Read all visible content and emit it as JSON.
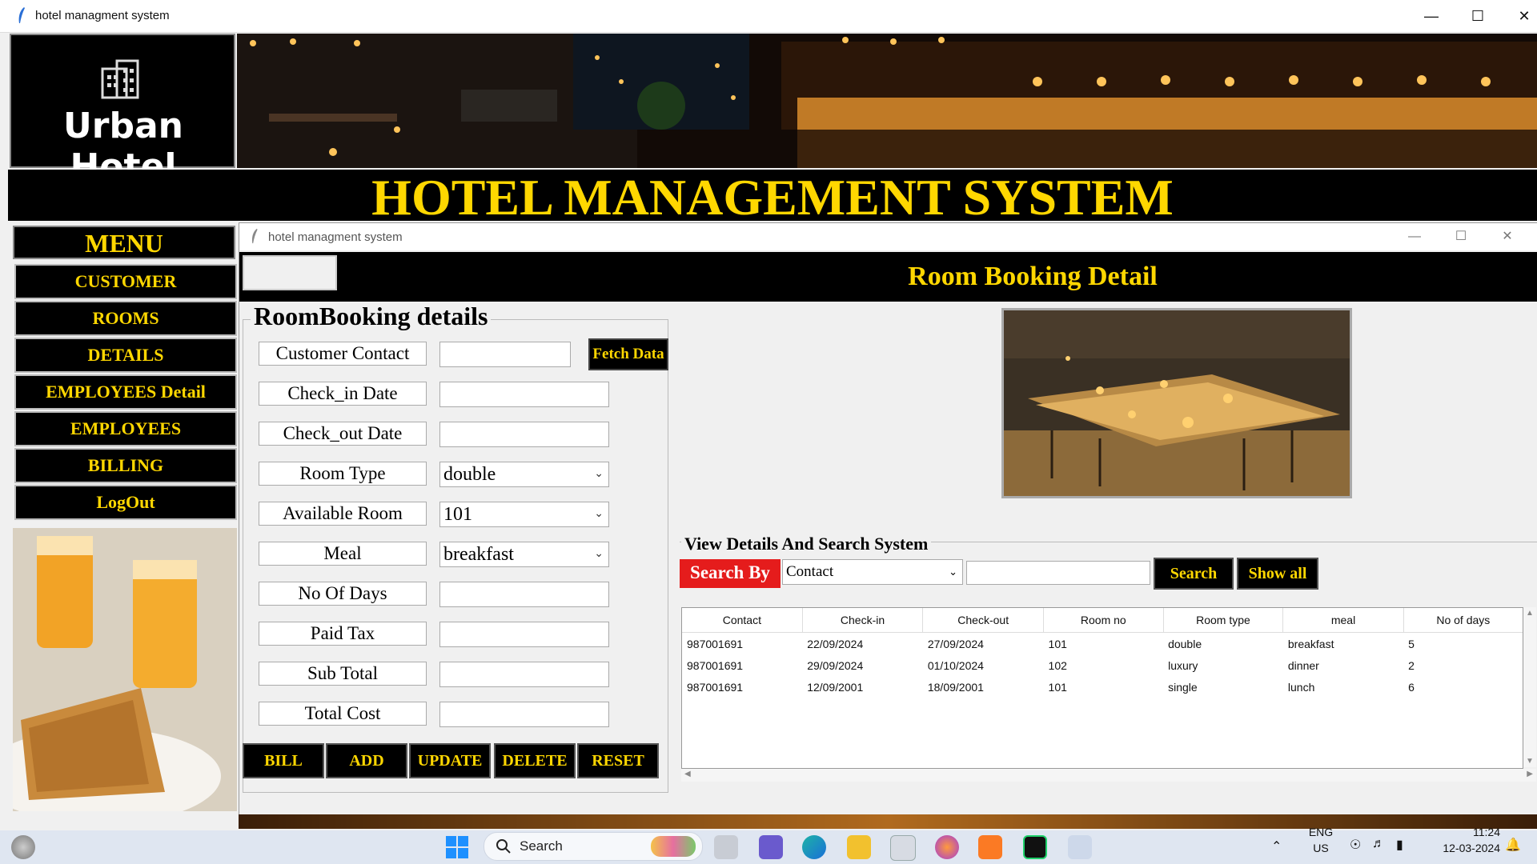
{
  "window": {
    "title": "hotel managment system"
  },
  "header": {
    "logo": "Urban Hotel",
    "main_title": "HOTEL MANAGEMENT SYSTEM"
  },
  "menu": {
    "title": "MENU",
    "items": [
      "CUSTOMER",
      "ROOMS",
      "DETAILS",
      "EMPLOYEES Detail",
      "EMPLOYEES",
      "BILLING",
      "LogOut"
    ]
  },
  "child": {
    "title": "hotel managment system",
    "header_title": "Room Booking Detail",
    "form_title": "RoomBooking details",
    "fields": {
      "customer_contact": {
        "label": "Customer Contact",
        "value": ""
      },
      "checkin": {
        "label": "Check_in Date",
        "value": ""
      },
      "checkout": {
        "label": "Check_out Date",
        "value": ""
      },
      "room_type": {
        "label": "Room Type",
        "value": "double"
      },
      "available_room": {
        "label": "Available Room",
        "value": "101"
      },
      "meal": {
        "label": "Meal",
        "value": "breakfast"
      },
      "no_of_days": {
        "label": "No Of Days",
        "value": ""
      },
      "paid_tax": {
        "label": "Paid Tax",
        "value": ""
      },
      "sub_total": {
        "label": "Sub Total",
        "value": ""
      },
      "total_cost": {
        "label": "Total Cost",
        "value": ""
      }
    },
    "fetch_button": "Fetch Data",
    "actions": [
      "BILL",
      "ADD",
      "UPDATE",
      "DELETE",
      "RESET"
    ],
    "search": {
      "title": "View Details And Search System",
      "search_by_label": "Search By",
      "select_value": "Contact",
      "input_value": "",
      "search_button": "Search",
      "show_all_button": "Show all"
    },
    "table": {
      "columns": [
        "Contact",
        "Check-in",
        "Check-out",
        "Room no",
        "Room type",
        "meal",
        "No of days"
      ],
      "rows": [
        [
          "987001691",
          "22/09/2024",
          "27/09/2024",
          "101",
          "double",
          "breakfast",
          "5"
        ],
        [
          "987001691",
          "29/09/2024",
          "01/10/2024",
          "102",
          "luxury",
          "dinner",
          "2"
        ],
        [
          "987001691",
          "12/09/2001",
          "18/09/2001",
          "101",
          "single",
          "lunch",
          "6"
        ]
      ]
    }
  },
  "taskbar": {
    "search_label": "Search",
    "lang_top": "ENG",
    "lang_bottom": "US",
    "time": "11:24",
    "date": "12-03-2024"
  },
  "colors": {
    "accent_gold": "#ffd700",
    "search_red": "#e51c1c",
    "black": "#000000"
  }
}
